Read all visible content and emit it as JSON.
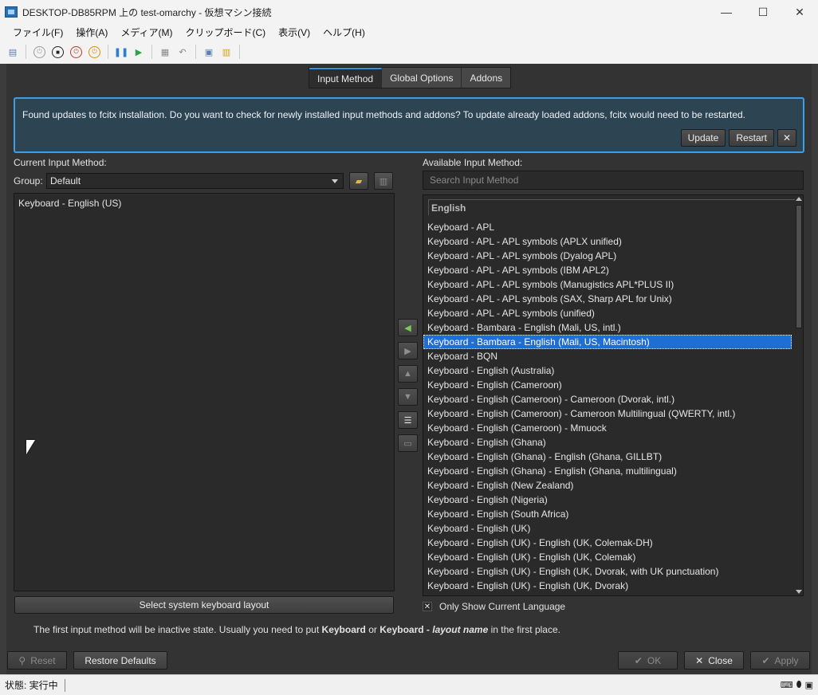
{
  "window": {
    "title": "DESKTOP-DB85RPM 上の test-omarchy  - 仮想マシン接続",
    "minimize": "—",
    "maximize": "☐",
    "close": "✕"
  },
  "menu": [
    "ファイル(F)",
    "操作(A)",
    "メディア(M)",
    "クリップボード(C)",
    "表示(V)",
    "ヘルプ(H)"
  ],
  "toolbar_icons": [
    "ctrl-alt-del-icon",
    "start-icon",
    "turn-off-icon",
    "shutdown-icon",
    "save-state-icon",
    "pause-icon",
    "resume-icon",
    "checkpoint-icon",
    "revert-icon",
    "enhanced-session-icon",
    "share-icon"
  ],
  "tabs": [
    {
      "label": "Input Method",
      "active": true
    },
    {
      "label": "Global Options",
      "active": false
    },
    {
      "label": "Addons",
      "active": false
    }
  ],
  "banner": {
    "message": "Found updates to fcitx installation. Do you want to check for newly installed input methods and addons? To update already loaded addons, fcitx would need to be restarted.",
    "update": "Update",
    "restart": "Restart",
    "dismiss": "✕"
  },
  "left": {
    "heading": "Current Input Method:",
    "group_label": "Group:",
    "group_value": "Default",
    "items": [
      "Keyboard - English (US)"
    ],
    "select_layout": "Select system keyboard layout"
  },
  "right": {
    "heading": "Available Input Method:",
    "search_placeholder": "Search Input Method",
    "category": "English",
    "items": [
      "Keyboard - APL",
      "Keyboard - APL - APL symbols (APLX unified)",
      "Keyboard - APL - APL symbols (Dyalog APL)",
      "Keyboard - APL - APL symbols (IBM APL2)",
      "Keyboard - APL - APL symbols (Manugistics APL*PLUS II)",
      "Keyboard - APL - APL symbols (SAX, Sharp APL for Unix)",
      "Keyboard - APL - APL symbols (unified)",
      "Keyboard - Bambara - English (Mali, US, intl.)",
      "Keyboard - Bambara - English (Mali, US, Macintosh)",
      "Keyboard - BQN",
      "Keyboard - English (Australia)",
      "Keyboard - English (Cameroon)",
      "Keyboard - English (Cameroon) - Cameroon (Dvorak, intl.)",
      "Keyboard - English (Cameroon) - Cameroon Multilingual (QWERTY, intl.)",
      "Keyboard - English (Cameroon) - Mmuock",
      "Keyboard - English (Ghana)",
      "Keyboard - English (Ghana) - English (Ghana, GILLBT)",
      "Keyboard - English (Ghana) - English (Ghana, multilingual)",
      "Keyboard - English (New Zealand)",
      "Keyboard - English (Nigeria)",
      "Keyboard - English (South Africa)",
      "Keyboard - English (UK)",
      "Keyboard - English (UK) - English (UK, Colemak-DH)",
      "Keyboard - English (UK) - English (UK, Colemak)",
      "Keyboard - English (UK) - English (UK, Dvorak, with UK punctuation)",
      "Keyboard - English (UK) - English (UK, Dvorak)"
    ],
    "selected_index": 8,
    "only_current_language": "Only Show Current Language",
    "only_current_checked": "✕"
  },
  "note": {
    "part1": "The first input method will be inactive state. Usually you need to put ",
    "bold1": "Keyboard",
    "part2": " or ",
    "bold2": "Keyboard - ",
    "italic": "layout name",
    "part3": " in the first place."
  },
  "footer": {
    "reset": "Reset",
    "restore_defaults": "Restore Defaults",
    "ok": "OK",
    "close": "Close",
    "apply": "Apply"
  },
  "statusbar": {
    "status": "状態: 実行中"
  },
  "colors": {
    "accent": "#3d9ee8",
    "selection": "#1f6ed4",
    "dialog_bg": "#333333"
  }
}
